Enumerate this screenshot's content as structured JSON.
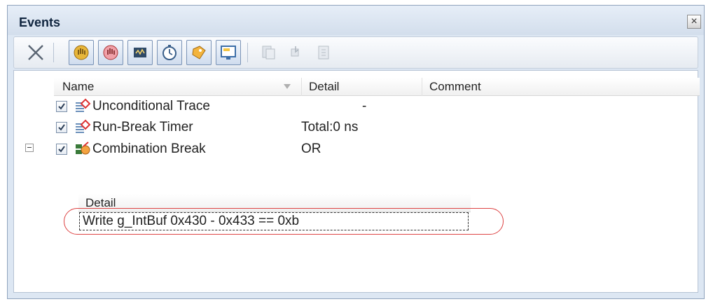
{
  "window": {
    "title": "Events",
    "close_glyph": "×"
  },
  "toolbar": {
    "buttons": [
      {
        "icon": "delete-x-icon",
        "enabled": true
      },
      {
        "icon": "hand-break-icon",
        "enabled": true
      },
      {
        "icon": "hand-break-alt-icon",
        "enabled": true
      },
      {
        "icon": "trace-event-icon",
        "enabled": true
      },
      {
        "icon": "timer-icon",
        "enabled": true
      },
      {
        "icon": "tag-event-icon",
        "enabled": true
      },
      {
        "icon": "monitor-event-icon",
        "enabled": true
      },
      {
        "icon": "copy-icon",
        "enabled": false
      },
      {
        "icon": "paste-icon",
        "enabled": false
      },
      {
        "icon": "export-icon",
        "enabled": false
      }
    ]
  },
  "table": {
    "columns": {
      "name": "Name",
      "detail": "Detail",
      "comment": "Comment"
    },
    "rows": [
      {
        "name": "Unconditional Trace",
        "detail": "-",
        "comment": "",
        "checked": true
      },
      {
        "name": "Run-Break Timer",
        "detail": "Total:0 ns",
        "comment": "",
        "checked": true
      },
      {
        "name": "Combination Break",
        "detail": "OR",
        "comment": "",
        "checked": true,
        "expanded": true
      }
    ],
    "sub_table": {
      "header": "Detail",
      "rows": [
        {
          "detail": "Write g_IntBuf 0x430 - 0x433 == 0xb"
        }
      ]
    }
  },
  "colors": {
    "accent": "#d44444",
    "panel_bg": "#dde7f3"
  }
}
